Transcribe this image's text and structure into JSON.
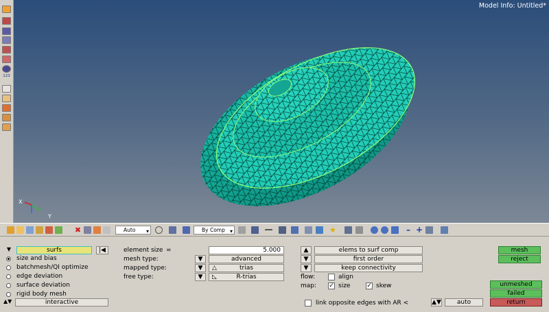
{
  "viewport": {
    "model_info": "Model Info: Untitled*",
    "axes": {
      "x": "X",
      "y": "Y"
    },
    "model_colors": {
      "fill": "#1ec8b4",
      "mesh": "#002820",
      "edge": "#8cff7a"
    }
  },
  "left_toolbar": {
    "icons": [
      "draw-mode-icon",
      "shaded-icon",
      "mesh-shaded-icon",
      "hidden-line-icon",
      "wireframe-icon",
      "element-icon",
      "ring-icon",
      "contour-icon",
      "numbers-icon",
      "plot-icon",
      "clip-icon",
      "results-icon",
      "stack-icon",
      "visualization-icon",
      "color-icon"
    ],
    "numbers_label": "123"
  },
  "bottom_toolbar": {
    "auto_dropdown": "Auto",
    "by_comp_dropdown": "By Comp"
  },
  "panel": {
    "entity_selector": "surfs",
    "options": [
      {
        "label": "size and bias",
        "selected": true
      },
      {
        "label": "batchmesh/QI optimize",
        "selected": false
      },
      {
        "label": "edge deviation",
        "selected": false
      },
      {
        "label": "surface deviation",
        "selected": false
      },
      {
        "label": "rigid body mesh",
        "selected": false
      }
    ],
    "interactive_label": "interactive",
    "element_size_label": "element size",
    "element_size_eq": "=",
    "element_size_value": "5.000",
    "mesh_type_label": "mesh type:",
    "mesh_type_value": "advanced",
    "mapped_type_label": "mapped type:",
    "mapped_type_value": "trias",
    "free_type_label": "free type:",
    "free_type_value": "R-trias",
    "elems_to_surf_comp": "elems to surf comp",
    "first_order": "first order",
    "keep_connectivity": "keep connectivity",
    "flow_label": "flow:",
    "align_label": "align",
    "map_label": "map:",
    "size_label": "size",
    "skew_label": "skew",
    "link_opposite_label": "link opposite edges with AR <",
    "auto_button": "auto",
    "mesh_button": "mesh",
    "reject_button": "reject",
    "unmeshed_button": "unmeshed",
    "failed_button": "failed",
    "return_button": "return"
  }
}
